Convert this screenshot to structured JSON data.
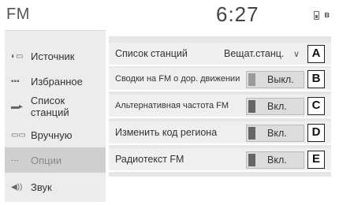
{
  "header": {
    "title": "FM",
    "clock": "6:27",
    "status_icons": [
      "phone-battery-icon",
      "bluetooth-icon"
    ],
    "bluetooth_glyph": "ʙ"
  },
  "sidebar": {
    "items": [
      {
        "label": "Источник",
        "icon": "source-icon",
        "glyph": "◐▭"
      },
      {
        "label": "Избранное",
        "icon": "favorites-icon",
        "glyph": "▪▪▪"
      },
      {
        "label": "Список станций",
        "icon": "station-list-icon",
        "glyph": "▬▸"
      },
      {
        "label": "Вручную",
        "icon": "manual-tuning-icon",
        "glyph": "▭▭"
      },
      {
        "label": "Опции",
        "icon": "options-icon",
        "glyph": "···",
        "selected": true
      },
      {
        "label": "Звук",
        "icon": "sound-icon",
        "glyph": "◀))"
      }
    ]
  },
  "settings": {
    "rows": [
      {
        "label": "Список станций",
        "value": "Вещат.станц.",
        "control": "dropdown",
        "marker": "A"
      },
      {
        "label": "Сводки на FM о дор. движении",
        "value": "Выкл.",
        "control": "toggle",
        "on": false,
        "marker": "B"
      },
      {
        "label": "Альтернативная частота FM",
        "value": "Вкл.",
        "control": "toggle",
        "on": true,
        "marker": "C"
      },
      {
        "label": "Изменить код региона",
        "value": "Вкл.",
        "control": "toggle",
        "on": true,
        "marker": "D"
      },
      {
        "label": "Радиотекст FM",
        "value": "Вкл.",
        "control": "toggle",
        "on": true,
        "marker": "E"
      }
    ]
  },
  "colors": {
    "sidebar_bg": "#ececec",
    "selected_bg": "#cfcfcf",
    "row_bg": "#efefef",
    "toggle_on": "#666666",
    "toggle_off": "#9a9a9a"
  }
}
